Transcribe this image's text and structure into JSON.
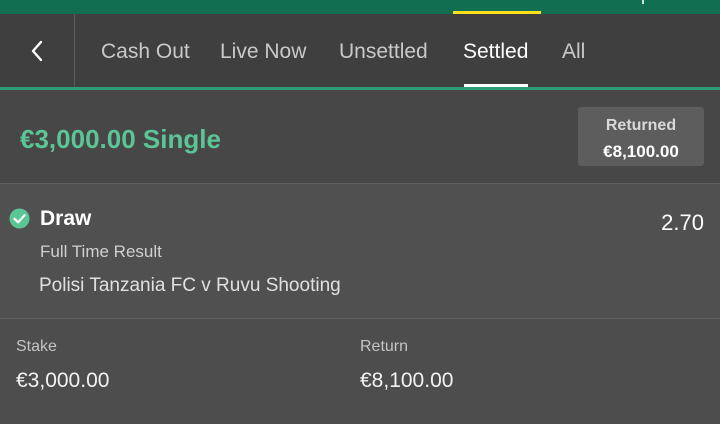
{
  "colors": {
    "brand_green": "#126e51",
    "accent_yellow": "#ffdf1b",
    "nav_underline_green": "#2d9e78",
    "title_green": "#5bc596"
  },
  "nav": {
    "back_icon": "chevron-left-icon",
    "tabs": [
      {
        "label": "Cash Out",
        "active": false
      },
      {
        "label": "Live Now",
        "active": false
      },
      {
        "label": "Unsettled",
        "active": false
      },
      {
        "label": "Settled",
        "active": true
      },
      {
        "label": "All",
        "active": false
      }
    ]
  },
  "bet": {
    "title": "€3,000.00 Single",
    "returned_label": "Returned",
    "returned_value": "€8,100.00"
  },
  "selection": {
    "status_icon": "check-circle-icon",
    "name": "Draw",
    "odds": "2.70",
    "market": "Full Time Result",
    "event": "Polisi Tanzania FC v Ruvu Shooting"
  },
  "summary": {
    "stake_label": "Stake",
    "stake_value": "€3,000.00",
    "return_label": "Return",
    "return_value": "€8,100.00"
  }
}
